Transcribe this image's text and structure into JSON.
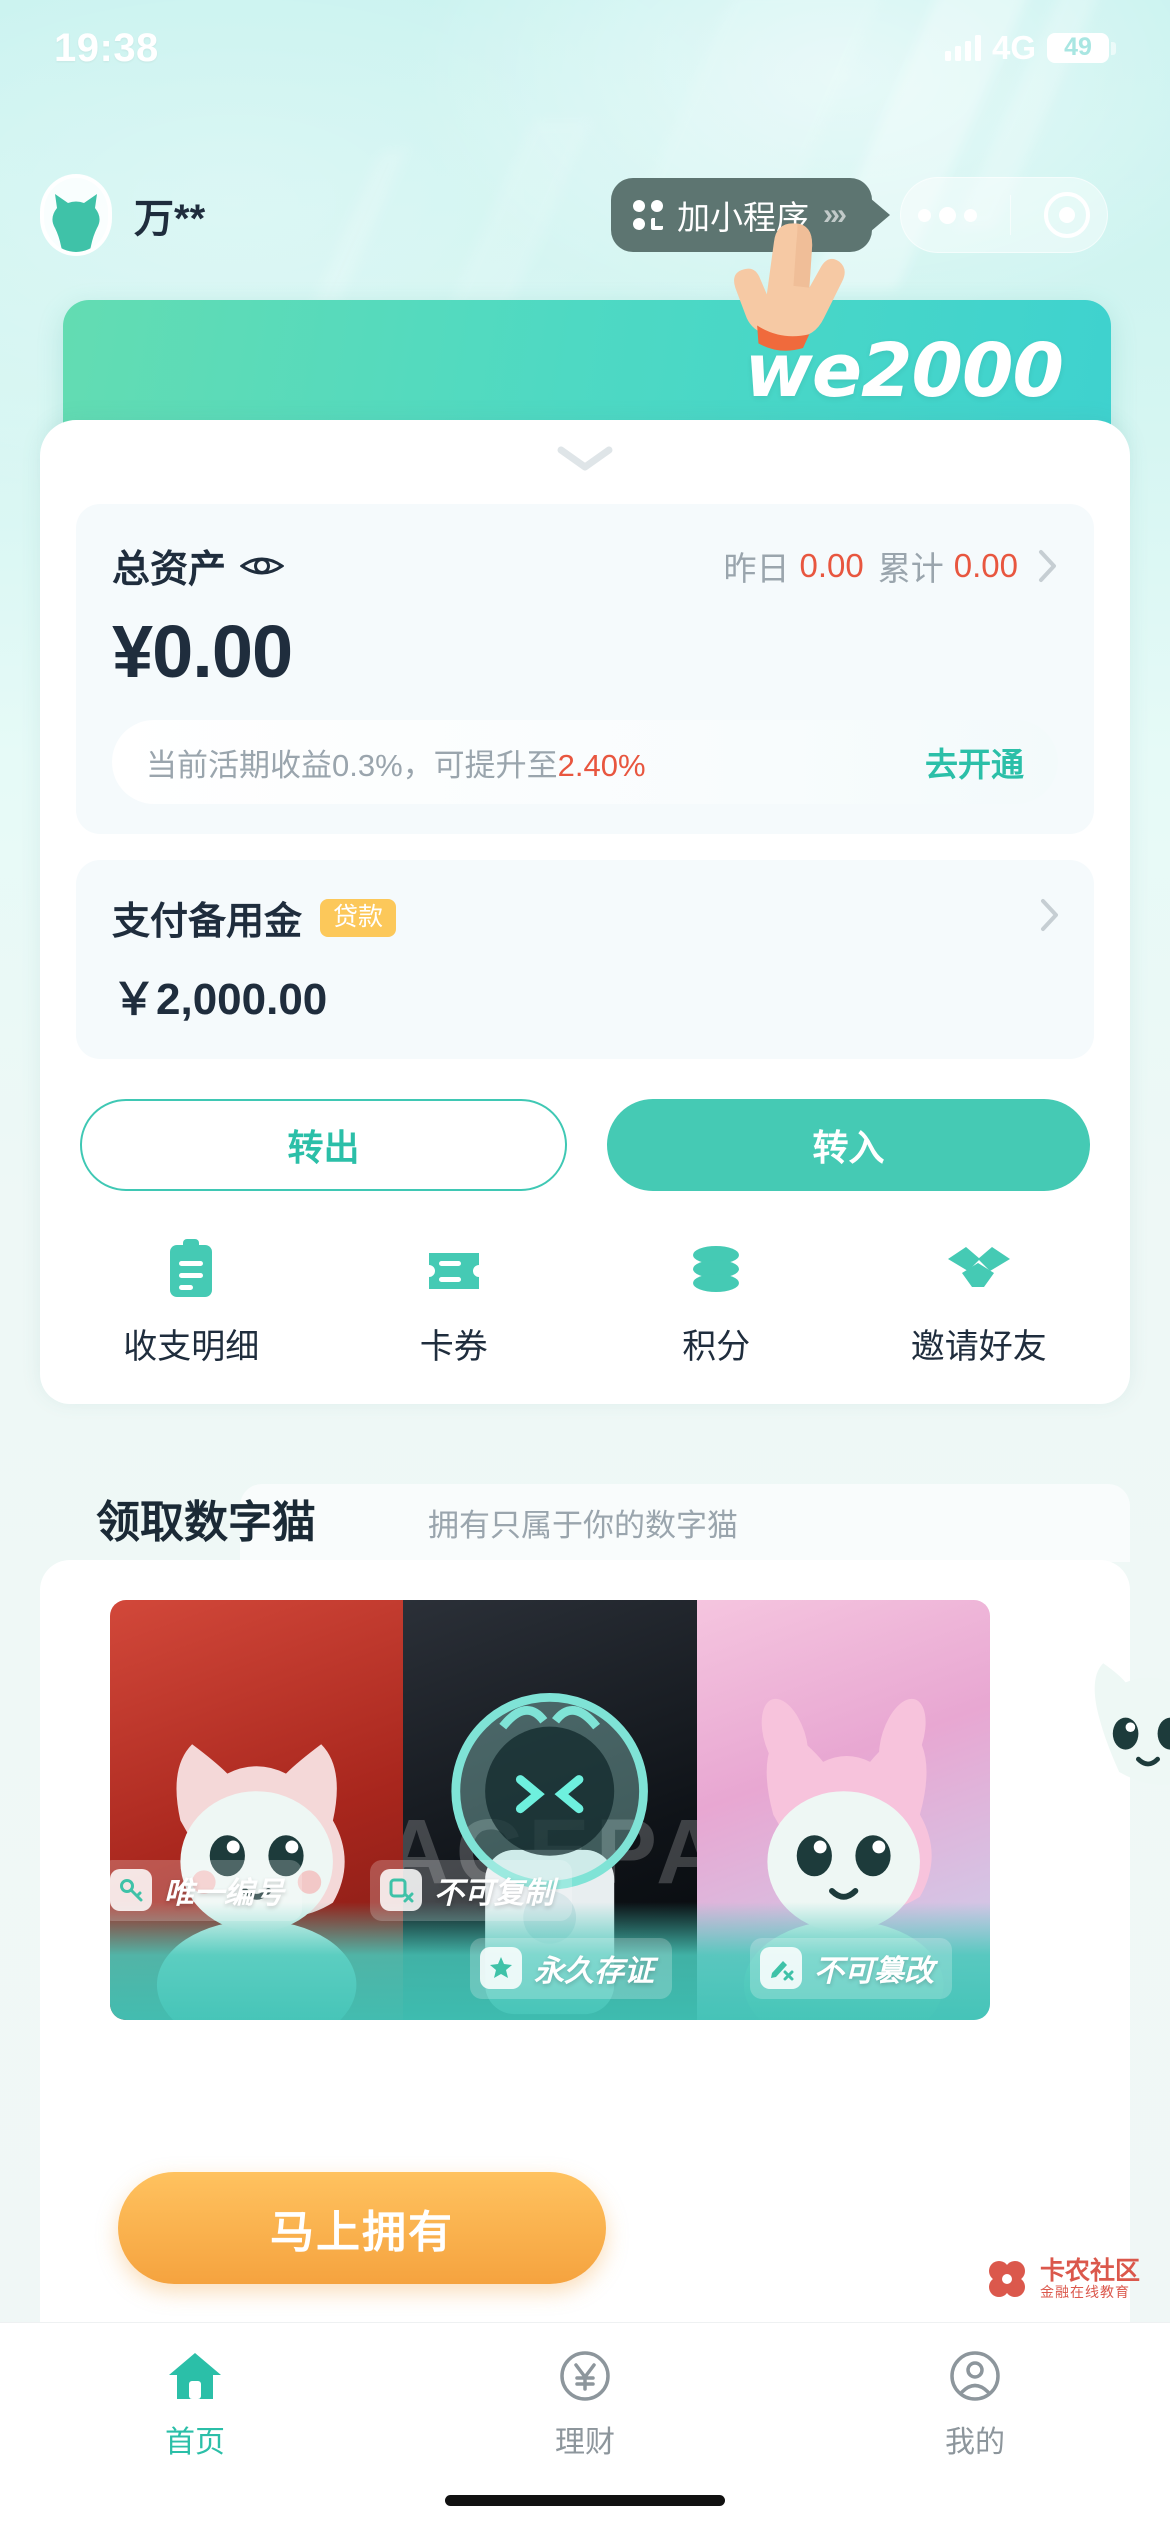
{
  "status_bar": {
    "time": "19:38",
    "network": "4G",
    "battery": "49",
    "signal_icon": "signal-bars-icon"
  },
  "header": {
    "avatar_icon": "cat-avatar-icon",
    "username": "万**",
    "tip": {
      "icon": "mini-program-grid-icon",
      "label": "加小程序",
      "chevrons": "›››"
    },
    "capsule": {
      "more_icon": "more-dots-icon",
      "target_icon": "capsule-target-icon"
    }
  },
  "banner": {
    "logo_text": "we2000",
    "hand_icon": "pointing-hand-icon"
  },
  "sheet": {
    "collapse_icon": "chevron-down-icon",
    "asset": {
      "title": "总资产",
      "eye_icon": "eye-icon",
      "yesterday_label": "昨日",
      "yesterday_value": "0.00",
      "total_label": "累计",
      "total_value": "0.00",
      "arrow_icon": "chevron-right-icon",
      "amount": "¥0.00",
      "rate_prefix": "当前活期收益0.3%，可提升至",
      "rate_highlight": "2.40%",
      "rate_cta": "去开通"
    },
    "reserve": {
      "title": "支付备用金",
      "badge": "贷款",
      "arrow_icon": "chevron-right-icon",
      "amount": "￥2,000.00"
    },
    "buttons": {
      "transfer_out": "转出",
      "transfer_in": "转入"
    },
    "quick_actions": [
      {
        "label": "收支明细",
        "icon": "bill-list-icon"
      },
      {
        "label": "卡券",
        "icon": "coupon-ticket-icon"
      },
      {
        "label": "积分",
        "icon": "coins-stack-icon"
      },
      {
        "label": "邀请好友",
        "icon": "handshake-icon"
      }
    ]
  },
  "digital_cat": {
    "title": "领取数字猫",
    "subtitle": "拥有只属于你的数字猫",
    "cards": [
      {
        "name": "red-festival-cat-card",
        "ghost_text": ""
      },
      {
        "name": "astronaut-cat-card",
        "ghost_text": "ACEPA"
      },
      {
        "name": "pink-bunny-cat-card",
        "ghost_text": ""
      }
    ],
    "peek_cat_icon": "peek-cat-icon",
    "tags": [
      {
        "label": "唯一编号",
        "icon": "key-icon"
      },
      {
        "label": "不可复制",
        "icon": "copy-block-icon"
      },
      {
        "label": "永久存证",
        "icon": "star-shield-icon"
      },
      {
        "label": "不可篡改",
        "icon": "edit-block-icon"
      }
    ],
    "cta": "马上拥有"
  },
  "tabbar": [
    {
      "label": "首页",
      "icon": "home-icon",
      "active": true
    },
    {
      "label": "理财",
      "icon": "yuan-circle-icon",
      "active": false
    },
    {
      "label": "我的",
      "icon": "person-circle-icon",
      "active": false
    }
  ],
  "watermark": {
    "line1": "卡农社区",
    "line2": "金融在线教育",
    "icon": "clover-icon"
  },
  "colors": {
    "brand_teal": "#2bbfa8",
    "accent_red": "#e8563f",
    "badge_orange": "#fcc85a",
    "cta_orange": "#f5a33f"
  }
}
